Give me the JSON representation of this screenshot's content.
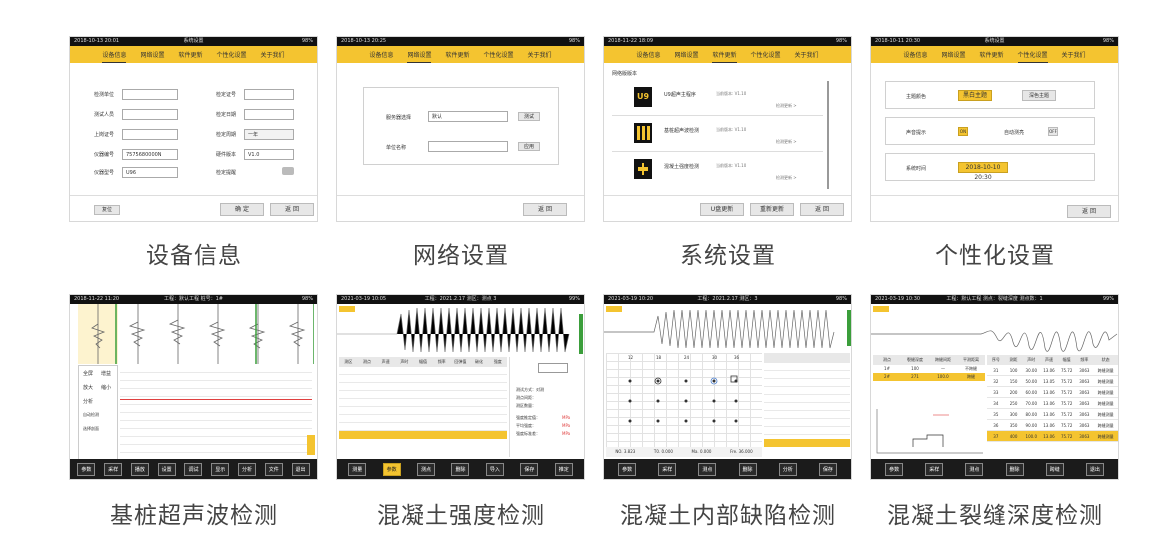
{
  "captions": [
    "设备信息",
    "网络设置",
    "系统设置",
    "个性化设置",
    "基桩超声波检测",
    "混凝土强度检测",
    "混凝土内部缺陷检测",
    "混凝土裂缝深度检测"
  ],
  "settings_tabs": [
    "设备信息",
    "网络设置",
    "软件更新",
    "个性化设置",
    "关于我们"
  ],
  "status": {
    "s1_time": "2018-10-13 20:01",
    "s1_title": "系统设置",
    "s2_time": "2018-10-13 20:25",
    "s3_time": "2018-11-22 18:09",
    "s4_time": "2018-10-11 20:30",
    "s4_title": "系统设置",
    "battery": "98%"
  },
  "device_info": {
    "left_labels": [
      "检测单位",
      "测试人员",
      "上岗证号",
      "仪器编号",
      "仪器型号"
    ],
    "left_values": [
      "",
      "",
      "",
      "7575680000N",
      "U96"
    ],
    "right_labels": [
      "检定证号",
      "检定日期",
      "检定周期",
      "硬件版本",
      "检定提醒"
    ],
    "right_values": [
      "",
      "",
      "一年",
      "V1.0",
      ""
    ],
    "reset": "复位",
    "btn_ok": "确 定",
    "btn_back": "返 回"
  },
  "network": {
    "server_label": "服务器选择",
    "server_value": "默认",
    "test_btn": "测试",
    "unit_label": "单位名称",
    "apply_btn": "应用",
    "back_btn": "返 回"
  },
  "software": {
    "header": "网络版版本",
    "items": [
      {
        "name": "U9超声主程序",
        "ver": "当前版本: V1.10",
        "action": "检测更新 >"
      },
      {
        "name": "基桩超声波检测",
        "ver": "当前版本: V1.10",
        "action": "检测更新 >"
      },
      {
        "name": "混凝土强度检测",
        "ver": "当前版本: V1.10",
        "action": "检测更新 >"
      }
    ],
    "icon_text": "U9",
    "btn_update": "U盘更新",
    "btn_reboot": "重新更新",
    "btn_back": "返 回"
  },
  "personal": {
    "theme_label": "主题颜色",
    "theme_a": "黑白主题",
    "theme_b": "深色主题",
    "sound_label": "声音提示",
    "sound_on": "ON",
    "auto_label": "自动测亮",
    "auto_off": "OFF",
    "time_label": "系统时间",
    "time_value": "2018-10-10 20:30",
    "btn_back": "返 回"
  },
  "pile": {
    "status_left": "2018-11-22 11:20",
    "status_mid": "工程：默认工程  桩号：1#",
    "toolbar": [
      "参数",
      "采样",
      "播放",
      "设置",
      "调试",
      "显示",
      "分析",
      "文件",
      "退出"
    ],
    "side_items": [
      "全屏",
      "增益",
      "放大",
      "缩小",
      "分析",
      "自动检测",
      "选择剖面"
    ]
  },
  "strength": {
    "status_left": "2021-03-19 10:05",
    "status_mid": "工程：2021.2.17 测区：测点 3",
    "status_right": "99% ",
    "table_headers": [
      "测区",
      "测点",
      "声速",
      "声时",
      "幅值",
      "频率",
      "回弹值",
      "碳化",
      "强度"
    ],
    "rows": 10,
    "panel_lines": [
      "测试方式：对测",
      "测点间距：",
      "测区数量：",
      "强度推定值：",
      "平均强度：",
      "强度标准差："
    ],
    "percent": "MPa",
    "toolbar": [
      "测量",
      "参数",
      "测点",
      "删除",
      "导入",
      "保存",
      "推定"
    ]
  },
  "defect": {
    "status_left": "2021-03-19 10:20",
    "status_mid": "工程：2021.2.17 测区：3",
    "col_ticks": [
      "12",
      "18",
      "24",
      "30",
      "36"
    ],
    "readout": [
      "NO. 3.823",
      "T0. 0.000",
      "Ma. 0.000",
      "Fre. 36.000"
    ],
    "toolbar": [
      "参数",
      "采样",
      "测点",
      "删除",
      "分析",
      "保存"
    ]
  },
  "crack": {
    "status_left": "2021-03-19 10:30",
    "status_mid": "工程：默认工程  测点：裂缝深度  测点数：1",
    "status_right": "99% ",
    "left_headers": [
      "测点",
      "裂缝深度",
      "跨缝间距",
      "平测距离"
    ],
    "left_row1": [
      "1#",
      "100",
      "—",
      "不跨缝"
    ],
    "left_row2": [
      "2#",
      "271",
      "100.0",
      "跨缝"
    ],
    "right_headers": [
      "序号",
      "测距",
      "声时",
      "声速",
      "幅值",
      "频率",
      "状态"
    ],
    "right_rows": [
      [
        "31",
        "100",
        "30.00",
        "13.06",
        "75.72",
        "3063",
        "跨缝测量"
      ],
      [
        "32",
        "150",
        "50.00",
        "13.05",
        "75.72",
        "3063",
        "跨缝测量"
      ],
      [
        "33",
        "200",
        "60.00",
        "13.06",
        "75.72",
        "3063",
        "跨缝测量"
      ],
      [
        "34",
        "250",
        "70.00",
        "13.06",
        "75.72",
        "3063",
        "跨缝测量"
      ],
      [
        "35",
        "300",
        "80.00",
        "13.06",
        "75.72",
        "3063",
        "跨缝测量"
      ],
      [
        "36",
        "350",
        "90.00",
        "13.06",
        "75.72",
        "3063",
        "跨缝测量"
      ],
      [
        "37",
        "400",
        "100.0",
        "13.06",
        "75.72",
        "3063",
        "跨缝测量"
      ]
    ],
    "toolbar": [
      "参数",
      "采样",
      "测点",
      "删除",
      "跨缝",
      "退出"
    ]
  },
  "colors": {
    "accent": "#f4c430",
    "dark": "#111111",
    "wave": "#666666"
  }
}
